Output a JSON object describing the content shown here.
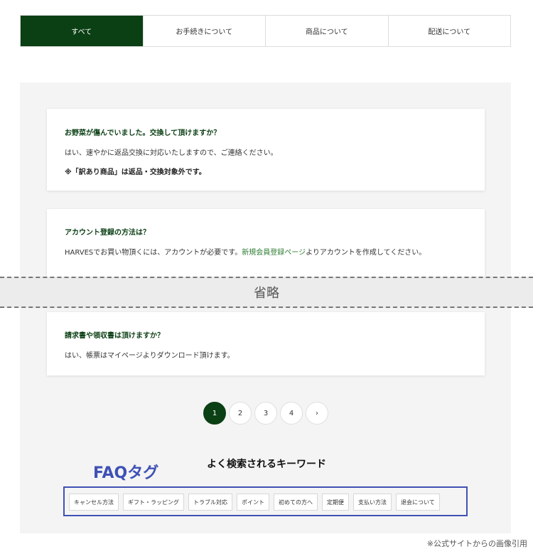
{
  "tabs": [
    {
      "label": "すべて"
    },
    {
      "label": "お手続きについて"
    },
    {
      "label": "商品について"
    },
    {
      "label": "配送について"
    }
  ],
  "faqs": [
    {
      "question": "お野菜が傷んでいました。交換して頂けますか？",
      "answer": "はい、速やかに返品交換に対応いたしますので、ご連絡ください。",
      "note": "※「訳あり商品」は返品・交換対象外です。"
    },
    {
      "question": "アカウント登録の方法は？",
      "answer_before": "HARVESでお買い物頂くには、アカウントが必要です。",
      "answer_link": "新規会員登録ページ",
      "answer_after": "よりアカウントを作成してください。"
    },
    {
      "question": "請求書や領収書は頂けますか？",
      "answer": "はい、帳票はマイページよりダウンロード頂けます。"
    }
  ],
  "omission_label": "省略",
  "pagination": {
    "pages": [
      "1",
      "2",
      "3",
      "4"
    ],
    "next": "›",
    "current": "1"
  },
  "keywords": {
    "title": "よく検索されるキーワード",
    "annotation": "FAQタグ",
    "tags": [
      "キャンセル方法",
      "ギフト・ラッピング",
      "トラブル対応",
      "ポイント",
      "初めての方へ",
      "定期便",
      "支払い方法",
      "退会について"
    ]
  },
  "credit": "※公式サイトからの画像引用",
  "colors": {
    "accent": "#0b3f14",
    "annotation": "#3f51b5",
    "link": "#2e7d32"
  }
}
